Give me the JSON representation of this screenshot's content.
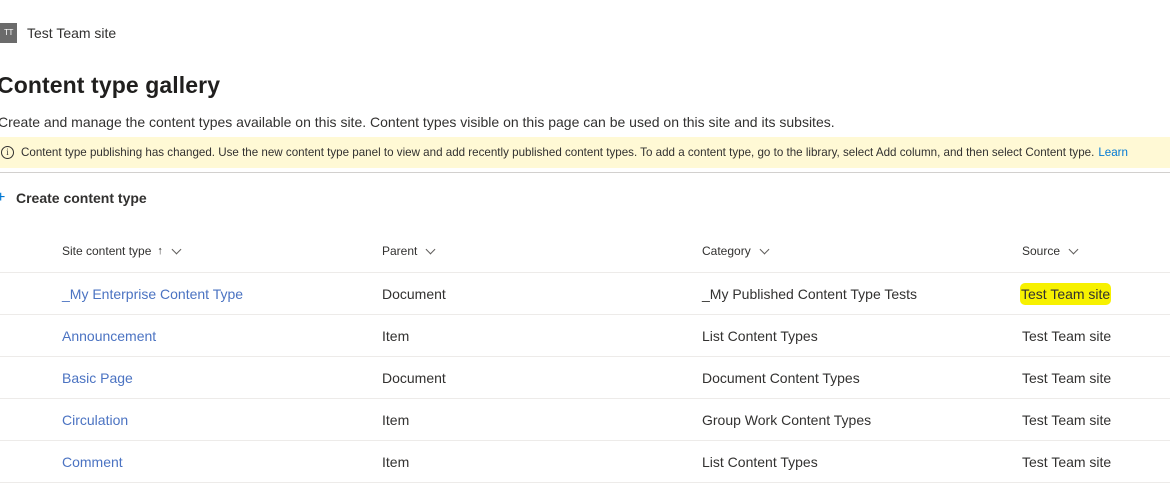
{
  "site": {
    "logo_initials": "TT",
    "name": "Test Team site"
  },
  "page": {
    "title": "Content type gallery",
    "description": "Create and manage the content types available on this site. Content types visible on this page can be used on this site and its subsites."
  },
  "banner": {
    "text": "Content type publishing has changed. Use the new content type panel to view and add recently published content types. To add a content type, go to the library, select Add column, and then select Content type.",
    "link": "Learn"
  },
  "toolbar": {
    "create_label": "Create content type"
  },
  "table": {
    "headers": {
      "name": "Site content type",
      "sort_glyph": "↑",
      "parent": "Parent",
      "category": "Category",
      "source": "Source"
    },
    "rows": [
      {
        "name": "_My Enterprise Content Type",
        "parent": "Document",
        "category": "_My Published Content Type Tests",
        "source": "Test Team site",
        "source_highlighted": true
      },
      {
        "name": "Announcement",
        "parent": "Item",
        "category": "List Content Types",
        "source": "Test Team site"
      },
      {
        "name": "Basic Page",
        "parent": "Document",
        "category": "Document Content Types",
        "source": "Test Team site"
      },
      {
        "name": "Circulation",
        "parent": "Item",
        "category": "Group Work Content Types",
        "source": "Test Team site"
      },
      {
        "name": "Comment",
        "parent": "Item",
        "category": "List Content Types",
        "source": "Test Team site"
      }
    ]
  },
  "colors": {
    "link": "#4b73c2",
    "accent": "#0078d4",
    "banner_bg": "#fff9d5",
    "highlight": "#f7f100"
  }
}
